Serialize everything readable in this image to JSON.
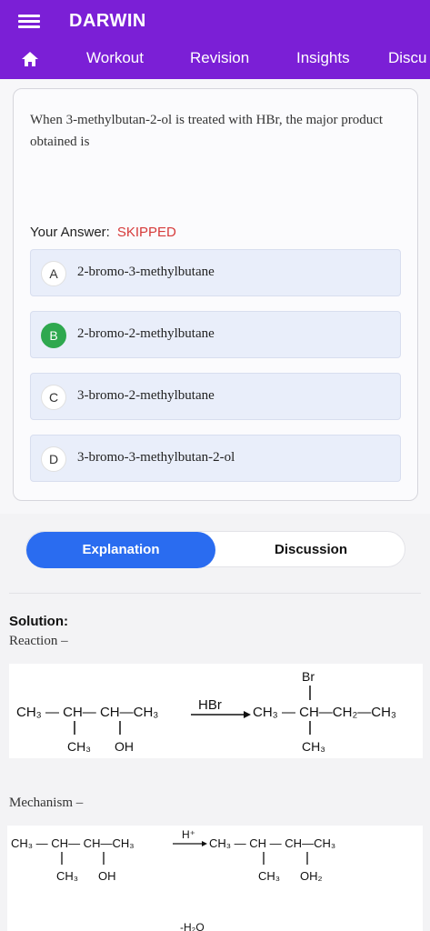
{
  "app": {
    "title": "DARWIN"
  },
  "nav": {
    "tabs": [
      "Workout",
      "Revision",
      "Insights",
      "Discu"
    ]
  },
  "question": {
    "text": "When 3-methylbutan-2-ol is treated with HBr, the major product obtained is",
    "your_answer_label": "Your Answer:",
    "your_answer_value": "SKIPPED",
    "options": [
      {
        "letter": "A",
        "text": "2-bromo-3-methylbutane",
        "correct": false
      },
      {
        "letter": "B",
        "text": "2-bromo-2-methylbutane",
        "correct": true
      },
      {
        "letter": "C",
        "text": "3-bromo-2-methylbutane",
        "correct": false
      },
      {
        "letter": "D",
        "text": "3-bromo-3-methylbutan-2-ol",
        "correct": false
      }
    ]
  },
  "toggle": {
    "explanation": "Explanation",
    "discussion": "Discussion"
  },
  "solution": {
    "label": "Solution:",
    "reaction_label": "Reaction –",
    "mechanism_label": "Mechanism –",
    "reaction": {
      "reactant_top": "CH₃ — CH— CH—CH₃",
      "reactant_sub1": "CH₃",
      "reactant_sub2": "OH",
      "reagent": "HBr",
      "product_top": "CH₃ — CH—CH₂—CH₃",
      "product_br": "Br",
      "product_sub": "CH₃"
    },
    "mechanism": {
      "left_top": "CH₃ — CH— CH—CH₃",
      "left_sub1": "CH₃",
      "left_sub2": "OH",
      "reagent": "H⁺",
      "right_top": "CH₃ — CH — CH—CH₃",
      "right_sub1": "CH₃",
      "right_sub2": "OH₂",
      "next_reagent": "-H₂O"
    }
  }
}
